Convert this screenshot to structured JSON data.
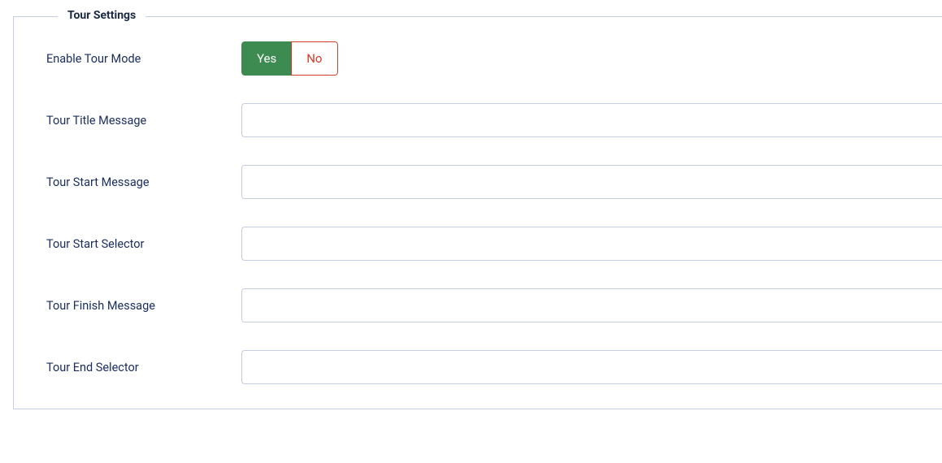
{
  "fieldset": {
    "legend": "Tour Settings"
  },
  "fields": {
    "enable_tour_mode": {
      "label": "Enable Tour Mode",
      "yes": "Yes",
      "no": "No",
      "selected": "yes"
    },
    "tour_title_message": {
      "label": "Tour Title Message",
      "value": ""
    },
    "tour_start_message": {
      "label": "Tour Start Message",
      "value": ""
    },
    "tour_start_selector": {
      "label": "Tour Start Selector",
      "value": ""
    },
    "tour_finish_message": {
      "label": "Tour Finish Message",
      "value": ""
    },
    "tour_end_selector": {
      "label": "Tour End Selector",
      "value": ""
    }
  }
}
